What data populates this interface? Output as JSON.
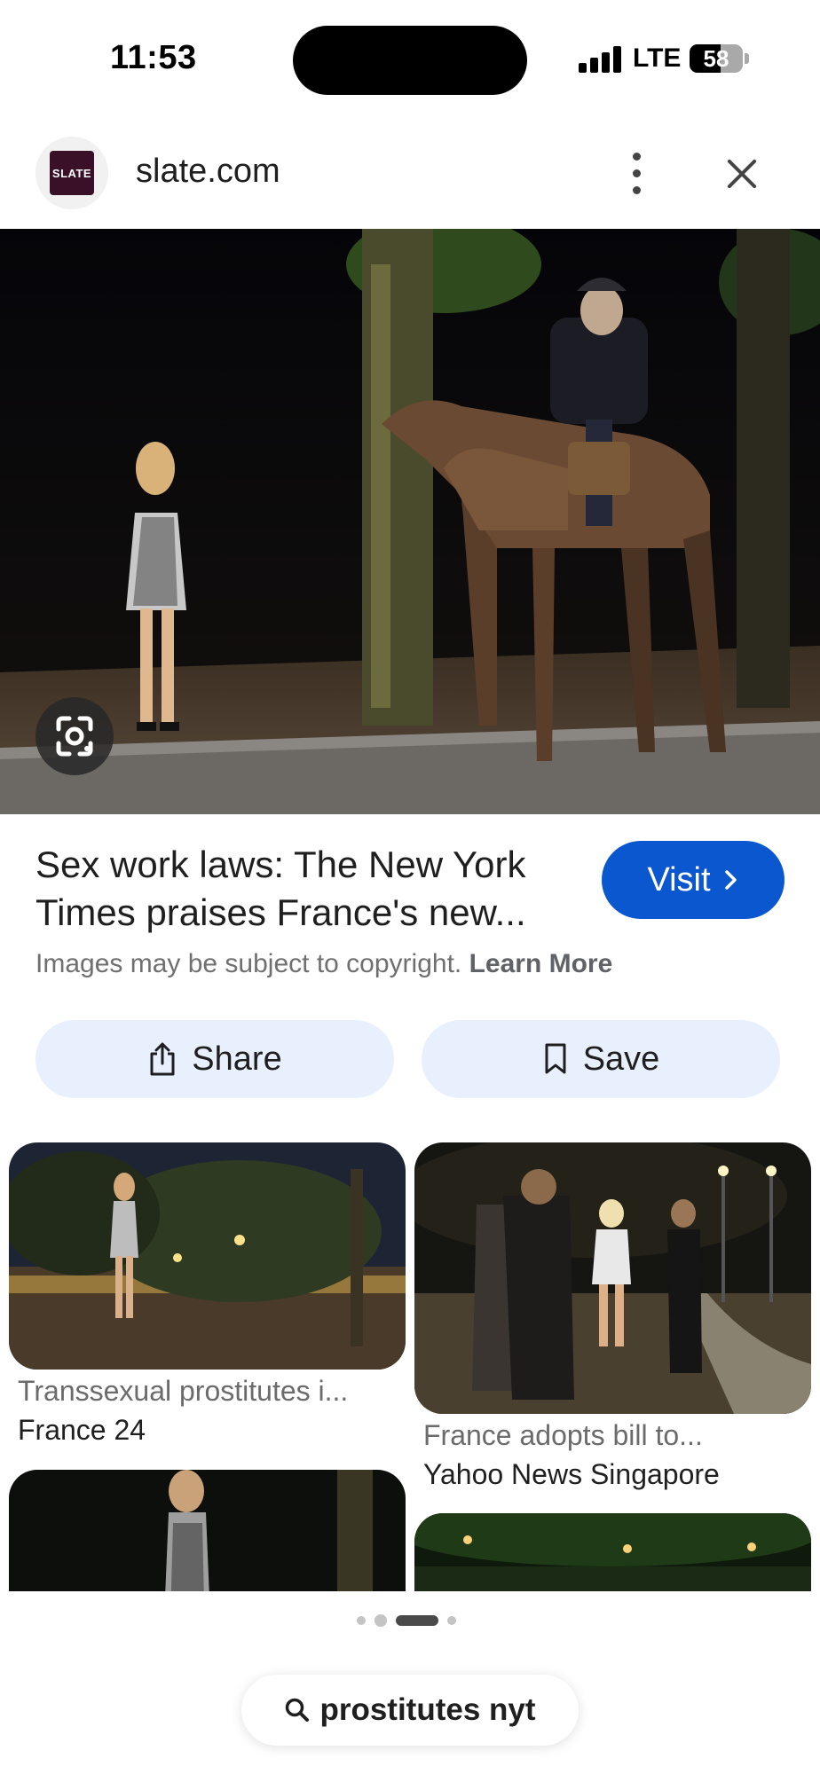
{
  "status_bar": {
    "time": "11:53",
    "network": "LTE",
    "battery": "58",
    "battery_level": 0.58
  },
  "header": {
    "site_logo_text": "SLATE",
    "site_name": "slate.com"
  },
  "result": {
    "title": "Sex work laws: The New York Times praises France's new...",
    "visit_label": "Visit",
    "copyright_text": "Images may be subject to copyright.",
    "learn_more_label": "Learn More",
    "share_label": "Share",
    "save_label": "Save"
  },
  "related": [
    {
      "title": "Transsexual prostitutes i...",
      "source": "France 24"
    },
    {
      "title": "France adopts bill to...",
      "source": "Yahoo News Singapore"
    }
  ],
  "pager": {
    "count": 4,
    "active": 2
  },
  "search": {
    "query": "prostitutes nyt"
  },
  "colors": {
    "accent": "#0b57d0",
    "chip_bg": "#e8f0fd"
  },
  "icons": [
    "slate-logo",
    "more-vert-icon",
    "close-icon",
    "lens-icon",
    "chevron-right-icon",
    "share-icon",
    "bookmark-icon",
    "search-icon"
  ]
}
